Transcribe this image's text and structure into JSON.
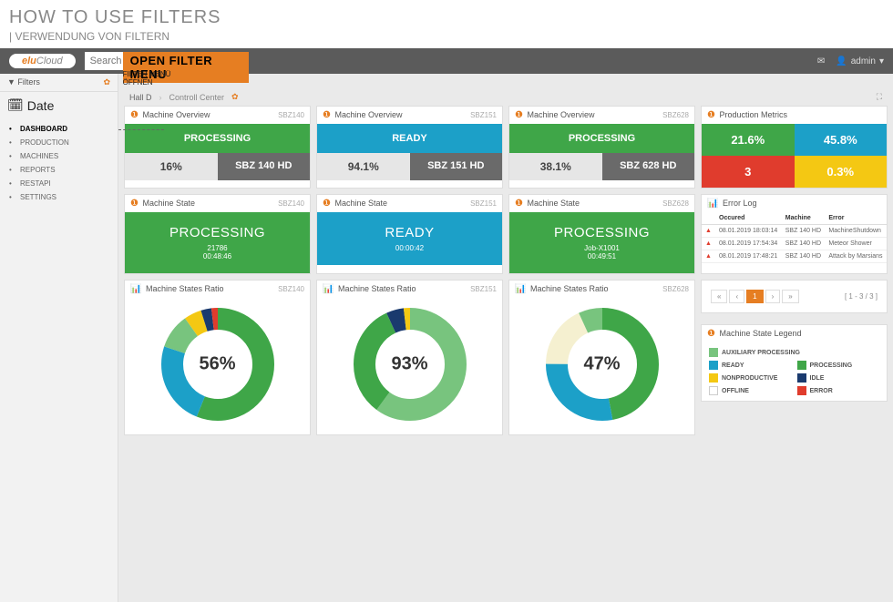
{
  "title": {
    "main": "HOW TO USE FILTERS",
    "sub": "| VERWENDUNG VON FILTERN"
  },
  "topbar": {
    "logo_pre": "elu",
    "logo_post": "Cloud",
    "search_placeholder": "Search",
    "overlay": "OPEN FILTER MENU",
    "overlay_sub1": "FILTER MENÜ",
    "overlay_sub2": "ÖFFNEN",
    "user": "admin",
    "msg_icon": "✉"
  },
  "sidebar": {
    "filters_label": "Filters",
    "date_label": "Date",
    "nav": [
      {
        "label": "DASHBOARD",
        "active": true
      },
      {
        "label": "PRODUCTION"
      },
      {
        "label": "MACHINES"
      },
      {
        "label": "REPORTS"
      },
      {
        "label": "RESTAPI"
      },
      {
        "label": "SETTINGS"
      }
    ]
  },
  "crumb": {
    "a": "Hall D",
    "b": "Controll Center"
  },
  "overview": [
    {
      "title": "Machine Overview",
      "tag": "SBZ140",
      "status": "PROCESSING",
      "status_cls": "green-b",
      "pct": "16%",
      "name": "SBZ 140 HD"
    },
    {
      "title": "Machine Overview",
      "tag": "SBZ151",
      "status": "READY",
      "status_cls": "blue-b",
      "pct": "94.1%",
      "name": "SBZ 151 HD"
    },
    {
      "title": "Machine Overview",
      "tag": "SBZ628",
      "status": "PROCESSING",
      "status_cls": "green-b",
      "pct": "38.1%",
      "name": "SBZ 628 HD"
    }
  ],
  "pm": {
    "title": "Production Metrics",
    "cells": [
      {
        "v": "21.6%",
        "cls": "pm-green"
      },
      {
        "v": "45.8%",
        "cls": "pm-blue"
      },
      {
        "v": "3",
        "cls": "pm-red"
      },
      {
        "v": "0.3%",
        "cls": "pm-yellow"
      }
    ]
  },
  "states": [
    {
      "title": "Machine State",
      "tag": "SBZ140",
      "cls": "green-b",
      "st": "PROCESSING",
      "s1": "21786",
      "s2": "00:48:46"
    },
    {
      "title": "Machine State",
      "tag": "SBZ151",
      "cls": "blue-b",
      "st": "READY",
      "s1": "",
      "s2": "00:00:42"
    },
    {
      "title": "Machine State",
      "tag": "SBZ628",
      "cls": "green-b",
      "st": "PROCESSING",
      "s1": "Job-X1001",
      "s2": "00:49:51"
    }
  ],
  "errlog": {
    "title": "Error Log",
    "headers": [
      "",
      "Occured",
      "Machine",
      "Error"
    ],
    "rows": [
      [
        "▲",
        "08.01.2019 18:03:14",
        "SBZ 140 HD",
        "MachineShutdown"
      ],
      [
        "▲",
        "08.01.2019 17:54:34",
        "SBZ 140 HD",
        "Meteor Shower"
      ],
      [
        "▲",
        "08.01.2019 17:48:21",
        "SBZ 140 HD",
        "Attack by Marsians"
      ]
    ]
  },
  "ratios": [
    {
      "title": "Machine States Ratio",
      "tag": "SBZ140",
      "pct": "56%"
    },
    {
      "title": "Machine States Ratio",
      "tag": "SBZ151",
      "pct": "93%"
    },
    {
      "title": "Machine States Ratio",
      "tag": "SBZ628",
      "pct": "47%"
    }
  ],
  "chart_data": [
    {
      "type": "pie",
      "title": "Machine States Ratio SBZ140",
      "center_label": "56%",
      "series": [
        {
          "name": "PROCESSING",
          "value": 56,
          "color": "#3fa648"
        },
        {
          "name": "READY",
          "value": 24,
          "color": "#1ca0c8"
        },
        {
          "name": "AUXILIARY PROCESSING",
          "value": 10,
          "color": "#78c47e"
        },
        {
          "name": "NONPRODUCTIVE",
          "value": 5,
          "color": "#f4c813"
        },
        {
          "name": "IDLE",
          "value": 3,
          "color": "#1a3a6e"
        },
        {
          "name": "ERROR",
          "value": 2,
          "color": "#e03c2d"
        }
      ]
    },
    {
      "type": "pie",
      "title": "Machine States Ratio SBZ151",
      "center_label": "93%",
      "series": [
        {
          "name": "AUXILIARY PROCESSING",
          "value": 60,
          "color": "#78c47e"
        },
        {
          "name": "PROCESSING",
          "value": 33,
          "color": "#3fa648"
        },
        {
          "name": "IDLE",
          "value": 5,
          "color": "#1a3a6e"
        },
        {
          "name": "NONPRODUCTIVE",
          "value": 2,
          "color": "#f4c813"
        }
      ]
    },
    {
      "type": "pie",
      "title": "Machine States Ratio SBZ628",
      "center_label": "47%",
      "series": [
        {
          "name": "PROCESSING",
          "value": 47,
          "color": "#3fa648"
        },
        {
          "name": "READY",
          "value": 28,
          "color": "#1ca0c8"
        },
        {
          "name": "OFFLINE",
          "value": 18,
          "color": "#f5f0d0"
        },
        {
          "name": "AUXILIARY PROCESSING",
          "value": 7,
          "color": "#78c47e"
        }
      ]
    }
  ],
  "pager": {
    "info": "[ 1 - 3 / 3 ]"
  },
  "legend": {
    "title": "Machine State Legend",
    "items": [
      {
        "name": "AUXILIARY PROCESSING",
        "cls": "c-aux",
        "full": true
      },
      {
        "name": "READY",
        "cls": "c-ready"
      },
      {
        "name": "PROCESSING",
        "cls": "c-proc"
      },
      {
        "name": "NONPRODUCTIVE",
        "cls": "c-np"
      },
      {
        "name": "IDLE",
        "cls": "c-idle"
      },
      {
        "name": "OFFLINE",
        "cls": "c-off"
      },
      {
        "name": "ERROR",
        "cls": "c-err"
      }
    ]
  }
}
